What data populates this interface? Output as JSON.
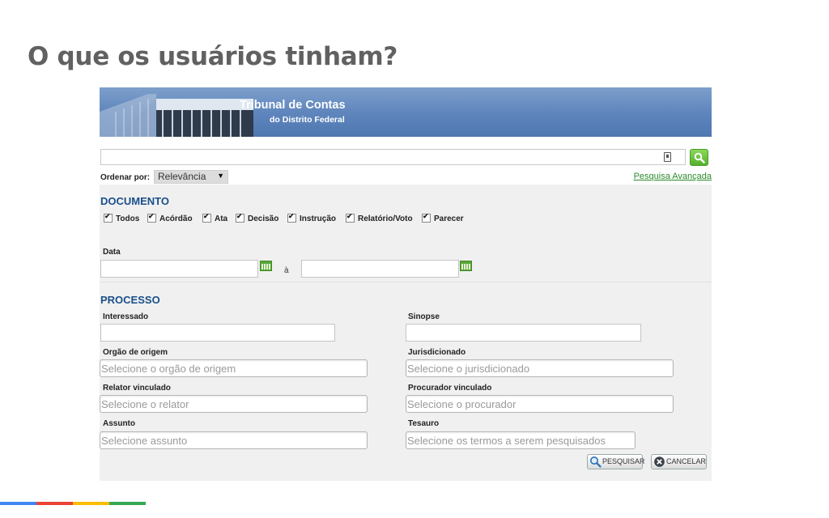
{
  "slide": {
    "title": "O que os usuários tinham?"
  },
  "banner": {
    "title": "Tribunal de Contas",
    "subtitle": "do Distrito Federal"
  },
  "search": {
    "value": "",
    "placeholder": ""
  },
  "order": {
    "label": "Ordenar por:",
    "selected": "Relevância"
  },
  "advanced_link": "Pesquisa Avançada",
  "documento": {
    "title": "DOCUMENTO",
    "checkboxes": [
      {
        "label": "Todos",
        "checked": true
      },
      {
        "label": "Acórdão",
        "checked": true
      },
      {
        "label": "Ata",
        "checked": true
      },
      {
        "label": "Decisão",
        "checked": true
      },
      {
        "label": "Instrução",
        "checked": true
      },
      {
        "label": "Relatório/Voto",
        "checked": true
      },
      {
        "label": "Parecer",
        "checked": true
      }
    ],
    "date_label": "Data",
    "date_separator": "à"
  },
  "processo": {
    "title": "PROCESSO",
    "interessado_label": "Interessado",
    "sinopse_label": "Sinopse",
    "orgao_label": "Orgão de origem",
    "orgao_placeholder": "Selecione o orgão de origem",
    "jurisdicionado_label": "Jurisdicionado",
    "jurisdicionado_placeholder": "Selecione o jurisdicionado",
    "relator_label": "Relator vinculado",
    "relator_placeholder": "Selecione o relator",
    "procurador_label": "Procurador vinculado",
    "procurador_placeholder": "Selecione o procurador",
    "assunto_label": "Assunto",
    "assunto_placeholder": "Selecione assunto",
    "tesauro_label": "Tesauro",
    "tesauro_placeholder": "Selecione os termos a serem pesquisados"
  },
  "buttons": {
    "search": "PESQUISAR",
    "cancel": "CANCELAR"
  },
  "colors": {
    "banner": "#5f86bd",
    "section_title": "#1a4f8a",
    "link": "#2a8a2a",
    "bar": [
      "#4285f4",
      "#ea4335",
      "#fbbc05",
      "#34a853"
    ]
  }
}
